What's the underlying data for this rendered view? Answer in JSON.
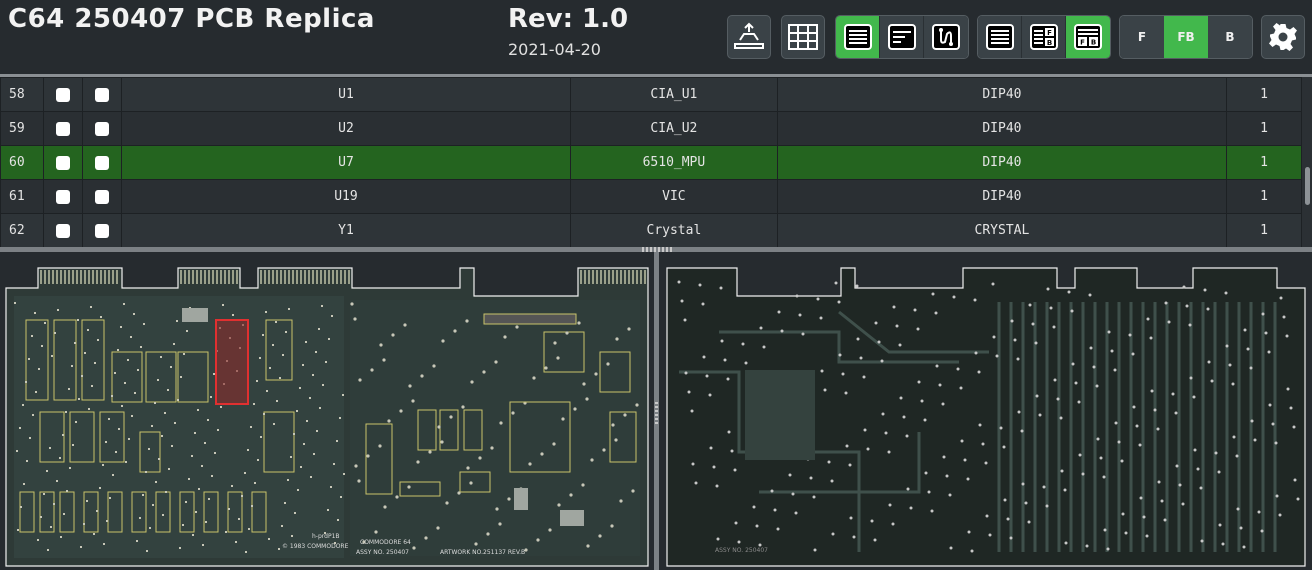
{
  "header": {
    "title": "C64 250407 PCB Replica",
    "revision": "Rev: 1.0",
    "date": "2021-04-20"
  },
  "toolbar": {
    "view_modes": [
      "bom-left-right-icon",
      "bom-top-bottom-icon",
      "netlist-icon"
    ],
    "active_view_mode": 0,
    "layout_modes": [
      "bom-only-icon",
      "left-right-layout-icon",
      "top-bottom-layout-icon"
    ],
    "active_layout_mode": 2,
    "layers": [
      "F",
      "FB",
      "B"
    ],
    "active_layer": "FB",
    "colors": {
      "active": "#42b84c",
      "button": "#3a4247"
    }
  },
  "bom": {
    "rows": [
      {
        "num": "58",
        "ref": "U1",
        "value": "CIA_U1",
        "footprint": "DIP40",
        "qty": "1"
      },
      {
        "num": "59",
        "ref": "U2",
        "value": "CIA_U2",
        "footprint": "DIP40",
        "qty": "1"
      },
      {
        "num": "60",
        "ref": "U7",
        "value": "6510_MPU",
        "footprint": "DIP40",
        "qty": "1",
        "highlighted": true
      },
      {
        "num": "61",
        "ref": "U19",
        "value": "VIC",
        "footprint": "DIP40",
        "qty": "1"
      },
      {
        "num": "62",
        "ref": "Y1",
        "value": "Crystal",
        "footprint": "CRYSTAL",
        "qty": "1"
      }
    ],
    "highlight_color": "#24641f"
  },
  "pcb_front": {
    "silk_text": [
      "COMMODORE 64",
      "ASSY NO. 250407",
      "ARTWORK NO.251137 REV.B",
      "© 1983 COMMODORE",
      "h-prdP1B"
    ],
    "highlight_color": "#e03030"
  },
  "pcb_back": {
    "silk_text": [
      "ASSY NO. 250407"
    ]
  }
}
